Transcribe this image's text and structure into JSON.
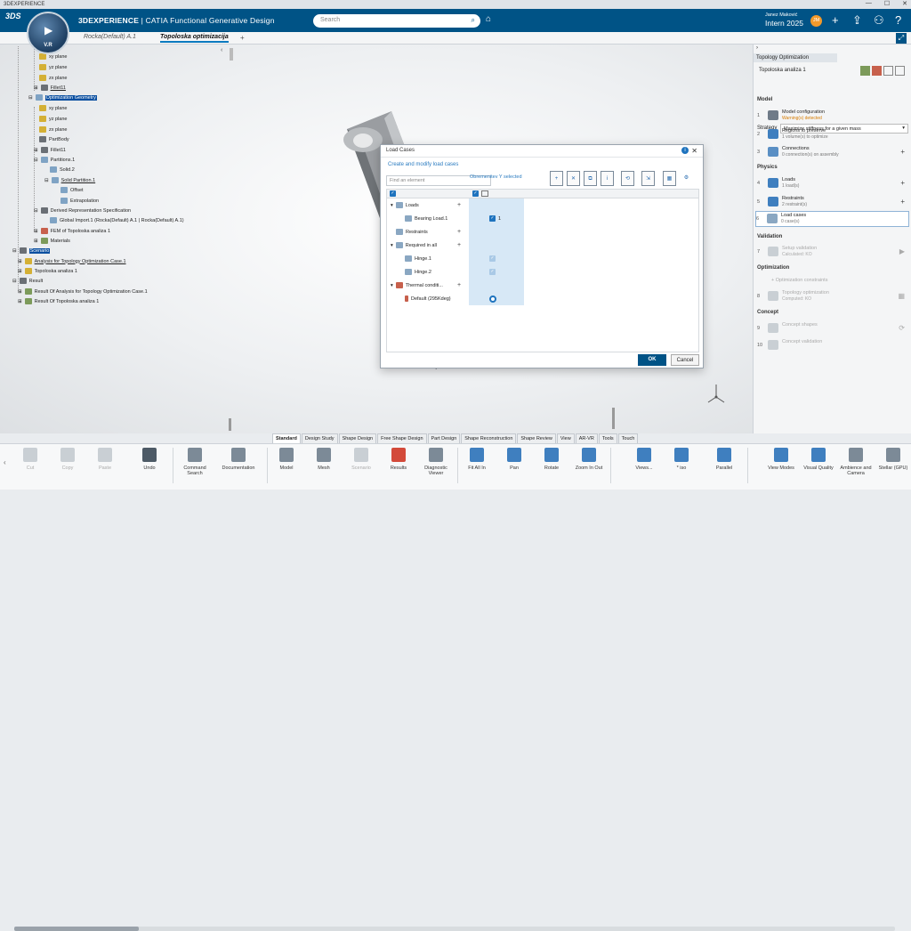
{
  "window": {
    "title": "3DEXPERIENCE"
  },
  "header": {
    "brand_bold": "3DEXPERIENCE",
    "brand_rest": " | CATIA Functional Generative Design",
    "search_placeholder": "Search",
    "user_name": "Janez Maković",
    "tenant": "Intern 2025",
    "avatar_initials": "JM",
    "compass_version": "V.R"
  },
  "tabs": [
    {
      "label": "Rocka(Default) A.1"
    },
    {
      "label": "Topoloska optimizacija"
    },
    {
      "label": "+"
    }
  ],
  "tree": [
    {
      "label": "xy plane"
    },
    {
      "label": "yz plane"
    },
    {
      "label": "zx plane"
    },
    {
      "label": "Fillet11"
    },
    {
      "label": "Optimization Geometry"
    },
    {
      "label": "xy plane"
    },
    {
      "label": "yz plane"
    },
    {
      "label": "zx plane"
    },
    {
      "label": "PartBody"
    },
    {
      "label": "Fillet11"
    },
    {
      "label": "Partitions.1"
    },
    {
      "label": "Solid.2"
    },
    {
      "label": "Solid Partition.1"
    },
    {
      "label": "Offset"
    },
    {
      "label": "Extrapolation"
    },
    {
      "label": "Derived Representation Specification"
    },
    {
      "label": "Global Import.1 (Rocka(Default) A.1 | Rocka(Default) A.1)"
    },
    {
      "label": "FEM of Topoloska analiza 1"
    },
    {
      "label": "Materials"
    },
    {
      "label": "Scenario"
    },
    {
      "label": "Analysis for Topology Optimization Case.1"
    },
    {
      "label": "Topoloska analiza 1"
    },
    {
      "label": "Result"
    },
    {
      "label": "Result Of Analysis for Topology Optimization Case.1"
    },
    {
      "label": "Result Of Topoloska analiza 1"
    }
  ],
  "panel": {
    "header": "Topology Optimization",
    "analysis": "Topoloska analiza 1",
    "strategy_label": "Strategy",
    "strategy_value": "Maximize stiffness for a given mass",
    "sections": {
      "model": "Model",
      "physics": "Physics",
      "validation": "Validation",
      "optimization": "Optimization",
      "concept": "Concept"
    },
    "items": [
      {
        "n": "1",
        "title": "Model configuration",
        "sub": "Warning(s) detected"
      },
      {
        "n": "2",
        "title": "Regions to preserve",
        "sub": "1 volume(s) to optimize"
      },
      {
        "n": "3",
        "title": "Connections",
        "sub": "0 connection(s) on assembly"
      },
      {
        "n": "4",
        "title": "Loads",
        "sub": "1 load(s)"
      },
      {
        "n": "5",
        "title": "Restraints",
        "sub": "2 restraint(s)"
      },
      {
        "n": "6",
        "title": "Load cases",
        "sub": "0 case(s)"
      },
      {
        "n": "7",
        "title": "Setup validation",
        "sub": "Calculated: KO"
      },
      {
        "n": "",
        "title": "Optimization constraints",
        "sub": ""
      },
      {
        "n": "8",
        "title": "Topology optimization",
        "sub": "Computed: KO"
      },
      {
        "n": "9",
        "title": "Concept shapes",
        "sub": ""
      },
      {
        "n": "10",
        "title": "Concept validation",
        "sub": ""
      }
    ]
  },
  "dialog": {
    "title": "Load Cases",
    "subtitle": "Create and modify load cases",
    "find_placeholder": "Find an element",
    "selected_info": "Obremenitev Y selected",
    "rows": [
      {
        "label": "Loads"
      },
      {
        "label": "Bearing Load.1",
        "value": "1"
      },
      {
        "label": "Restraints"
      },
      {
        "label": "Required in all"
      },
      {
        "label": "Hinge.1"
      },
      {
        "label": "Hinge.2"
      },
      {
        "label": "Thermal conditi..."
      },
      {
        "label": "Default (295Kdeg)"
      }
    ],
    "ok_label": "OK",
    "cancel_label": "Cancel"
  },
  "action_tabs": [
    "Standard",
    "Design Study",
    "Shape Design",
    "Free Shape Design",
    "Part Design",
    "Shape Reconstruction",
    "Shape Review",
    "View",
    "AR-VR",
    "Tools",
    "Touch"
  ],
  "commands": [
    {
      "label": "Cut"
    },
    {
      "label": "Copy"
    },
    {
      "label": "Paste"
    },
    {
      "label": "Undo"
    },
    {
      "label": "Command Search"
    },
    {
      "label": "Documentation"
    },
    {
      "label": "Model"
    },
    {
      "label": "Mesh"
    },
    {
      "label": "Scenario"
    },
    {
      "label": "Results"
    },
    {
      "label": "Diagnostic Viewer"
    },
    {
      "label": "Fit All In"
    },
    {
      "label": "Pan"
    },
    {
      "label": "Rotate"
    },
    {
      "label": "Zoom In Out"
    },
    {
      "label": "Views..."
    },
    {
      "label": "* iso"
    },
    {
      "label": "Parallel"
    },
    {
      "label": "View Modes"
    },
    {
      "label": "Visual Quality"
    },
    {
      "label": "Ambience and Camera"
    },
    {
      "label": "Stellar (GPU)"
    }
  ]
}
